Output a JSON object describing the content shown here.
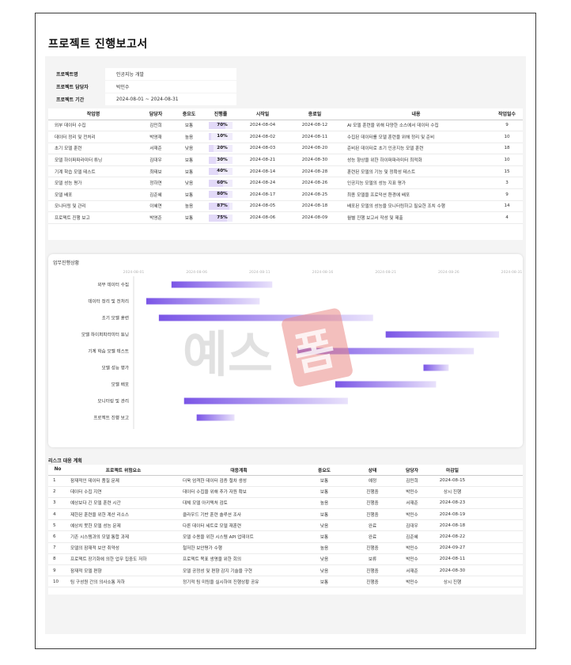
{
  "title": "프로젝트 진행보고서",
  "info": [
    {
      "key": "프로젝트명",
      "value": "인공지능 개발"
    },
    {
      "key": "프로젝트 담당자",
      "value": "박민수"
    },
    {
      "key": "프로젝트 기간",
      "value": "2024-08-01 ~ 2024-08-31"
    }
  ],
  "task_table": {
    "headers": [
      "작업명",
      "담당자",
      "중요도",
      "진행률",
      "시작일",
      "종료일",
      "내용",
      "작업일수"
    ],
    "rows": [
      {
        "name": "외부 데이터 수집",
        "owner": "김민희",
        "priority": "보통",
        "pri": "normal",
        "progress": 0.7,
        "progress_label": "70%",
        "start": "2024-08-04",
        "end": "2024-08-12",
        "desc": "AI 모델 훈련을 위해 다양한 소스에서 데이터 수집",
        "days": "9"
      },
      {
        "name": "데이터 정리 및 전처리",
        "owner": "박영재",
        "priority": "높음",
        "pri": "high",
        "progress": 0.1,
        "progress_label": "10%",
        "start": "2024-08-02",
        "end": "2024-08-11",
        "desc": "수집된 데이터를 모델 훈련을 위해 정리 및 준비",
        "days": "10"
      },
      {
        "name": "초기 모델 훈련",
        "owner": "서재준",
        "priority": "낮음",
        "pri": "low",
        "progress": 0.2,
        "progress_label": "20%",
        "start": "2024-08-03",
        "end": "2024-08-20",
        "desc": "준비된 데이터로 초기 인공지능 모델 훈련",
        "days": "18"
      },
      {
        "name": "모델 하이퍼파라미터 튜닝",
        "owner": "김대우",
        "priority": "보통",
        "pri": "normal",
        "progress": 0.3,
        "progress_label": "30%",
        "start": "2024-08-21",
        "end": "2024-08-30",
        "desc": "성능 향상을 위한 하이퍼파라미터 최적화",
        "days": "10"
      },
      {
        "name": "기계 학습 모델 테스트",
        "owner": "최태보",
        "priority": "보통",
        "pri": "normal",
        "progress": 0.4,
        "progress_label": "40%",
        "start": "2024-08-14",
        "end": "2024-08-28",
        "desc": "훈련된 모델의 기능 및 정확성 테스트",
        "days": "15"
      },
      {
        "name": "모델 성능 평가",
        "owner": "정하연",
        "priority": "낮음",
        "pri": "low",
        "progress": 0.6,
        "progress_label": "60%",
        "start": "2024-08-24",
        "end": "2024-08-26",
        "desc": "인공지능 모델의 성능 지표 평가",
        "days": "3"
      },
      {
        "name": "모델 배포",
        "owner": "김준혜",
        "priority": "보통",
        "pri": "normal",
        "progress": 0.8,
        "progress_label": "80%",
        "start": "2024-08-17",
        "end": "2024-08-25",
        "desc": "최종 모델을 프로덕션 환경에 배포",
        "days": "9"
      },
      {
        "name": "모니터링 및 관리",
        "owner": "이혜연",
        "priority": "높음",
        "pri": "high",
        "progress": 0.87,
        "progress_label": "87%",
        "start": "2024-08-05",
        "end": "2024-08-18",
        "desc": "배포된 모델의 성능을 모니터링하고 필요한 조치 수행",
        "days": "14"
      },
      {
        "name": "프로젝트 진행 보고",
        "owner": "박영준",
        "priority": "보통",
        "pri": "normal",
        "progress": 0.75,
        "progress_label": "75%",
        "start": "2024-08-06",
        "end": "2024-08-09",
        "desc": "월별 진행 보고서 작성 및 제출",
        "days": "4"
      }
    ]
  },
  "chart_data": {
    "type": "bar",
    "orientation": "horizontal",
    "title": "업무진행상황",
    "x_ticks": [
      "2024-08-01",
      "2024-08-06",
      "2024-08-11",
      "2024-08-16",
      "2024-08-21",
      "2024-08-26",
      "2024-08-31"
    ],
    "xlim": [
      "2024-08-01",
      "2024-08-31"
    ],
    "categories": [
      "외부 데이터 수집",
      "데이터 정리 및 전처리",
      "초기 모델 훈련",
      "모델 하이퍼파라미터 튜닝",
      "기계 학습 모델 테스트",
      "모델 성능 평가",
      "모델 배포",
      "모니터링 및 관리",
      "프로젝트 진행 보고"
    ],
    "start": [
      "2024-08-04",
      "2024-08-02",
      "2024-08-03",
      "2024-08-21",
      "2024-08-14",
      "2024-08-24",
      "2024-08-17",
      "2024-08-05",
      "2024-08-06"
    ],
    "end": [
      "2024-08-12",
      "2024-08-11",
      "2024-08-20",
      "2024-08-30",
      "2024-08-28",
      "2024-08-26",
      "2024-08-25",
      "2024-08-18",
      "2024-08-09"
    ],
    "colors": {
      "bar_start": "#7a55e6",
      "bar_end": "#e9e2fb"
    },
    "grid": false
  },
  "risk": {
    "title": "리스크 대응 계획",
    "headers": [
      "No",
      "프로젝트 위험요소",
      "대응계획",
      "중요도",
      "상태",
      "담당자",
      "마감일"
    ],
    "rows": [
      {
        "no": "1",
        "risk": "잠재적인 데이터 품질 문제",
        "plan": "더욱 엄격한 데이터 검증 절차 생성",
        "priority": "보통",
        "pri": "normal",
        "status": "예정",
        "st": "gray",
        "owner": "김민희",
        "due": "2024-08-15"
      },
      {
        "no": "2",
        "risk": "데이터 수집 지연",
        "plan": "데이터 수집을 위해 추가 자원 확보",
        "priority": "보통",
        "pri": "normal",
        "status": "진행중",
        "st": "green",
        "owner": "박민수",
        "due": "상시 진행"
      },
      {
        "no": "3",
        "risk": "예상보다 긴 모델 훈련 시간",
        "plan": "대체 모델 아키텍처 검토",
        "priority": "높음",
        "pri": "high",
        "status": "진행중",
        "st": "green",
        "owner": "서재준",
        "due": "2024-08-23"
      },
      {
        "no": "4",
        "risk": "제한된 훈련을 위한 계산 리소스",
        "plan": "클라우드 기반 훈련 솔루션 조사",
        "priority": "보통",
        "pri": "normal",
        "status": "진행중",
        "st": "green",
        "owner": "박민수",
        "due": "2024-08-19"
      },
      {
        "no": "5",
        "risk": "예상치 못한 모델 성능 문제",
        "plan": "다른 데이터 세트로 모델 재훈련",
        "priority": "낮음",
        "pri": "low",
        "status": "완료",
        "st": "red",
        "owner": "김대우",
        "due": "2024-08-18"
      },
      {
        "no": "6",
        "risk": "기존 시스템과의 모델 통합 과제",
        "plan": "모델 수용을 위한 시스템 API 업데이트",
        "priority": "보통",
        "pri": "normal",
        "status": "완료",
        "st": "red",
        "owner": "김준혜",
        "due": "2024-08-22"
      },
      {
        "no": "7",
        "risk": "모델의 잠재적 보안 취약성",
        "plan": "철저한 보안평가 수행",
        "priority": "높음",
        "pri": "high",
        "status": "진행중",
        "st": "green",
        "owner": "박민수",
        "due": "2024-09-27"
      },
      {
        "no": "8",
        "risk": "프로젝트 장기화에 의한 업무 집중도 저하",
        "plan": "프로젝트 목표 생명을 위한 회의",
        "priority": "낮음",
        "pri": "low",
        "status": "보류",
        "st": "gray",
        "owner": "박민수",
        "due": "2024-08-11"
      },
      {
        "no": "9",
        "risk": "잠재적 모델 편향",
        "plan": "모델 공정성 및 편향 감지 기술을 구현",
        "priority": "낮음",
        "pri": "low",
        "status": "진행중",
        "st": "green",
        "owner": "서재준",
        "due": "2024-08-30"
      },
      {
        "no": "10",
        "risk": "팀 구성원 간의 의사소통 저하",
        "plan": "정기적 팀 미팅을 실시하여 진행상황 공유",
        "priority": "보통",
        "pri": "normal",
        "status": "진행중",
        "st": "green",
        "owner": "박민수",
        "due": "상시 진행"
      }
    ]
  },
  "watermark_text": "예스폼"
}
